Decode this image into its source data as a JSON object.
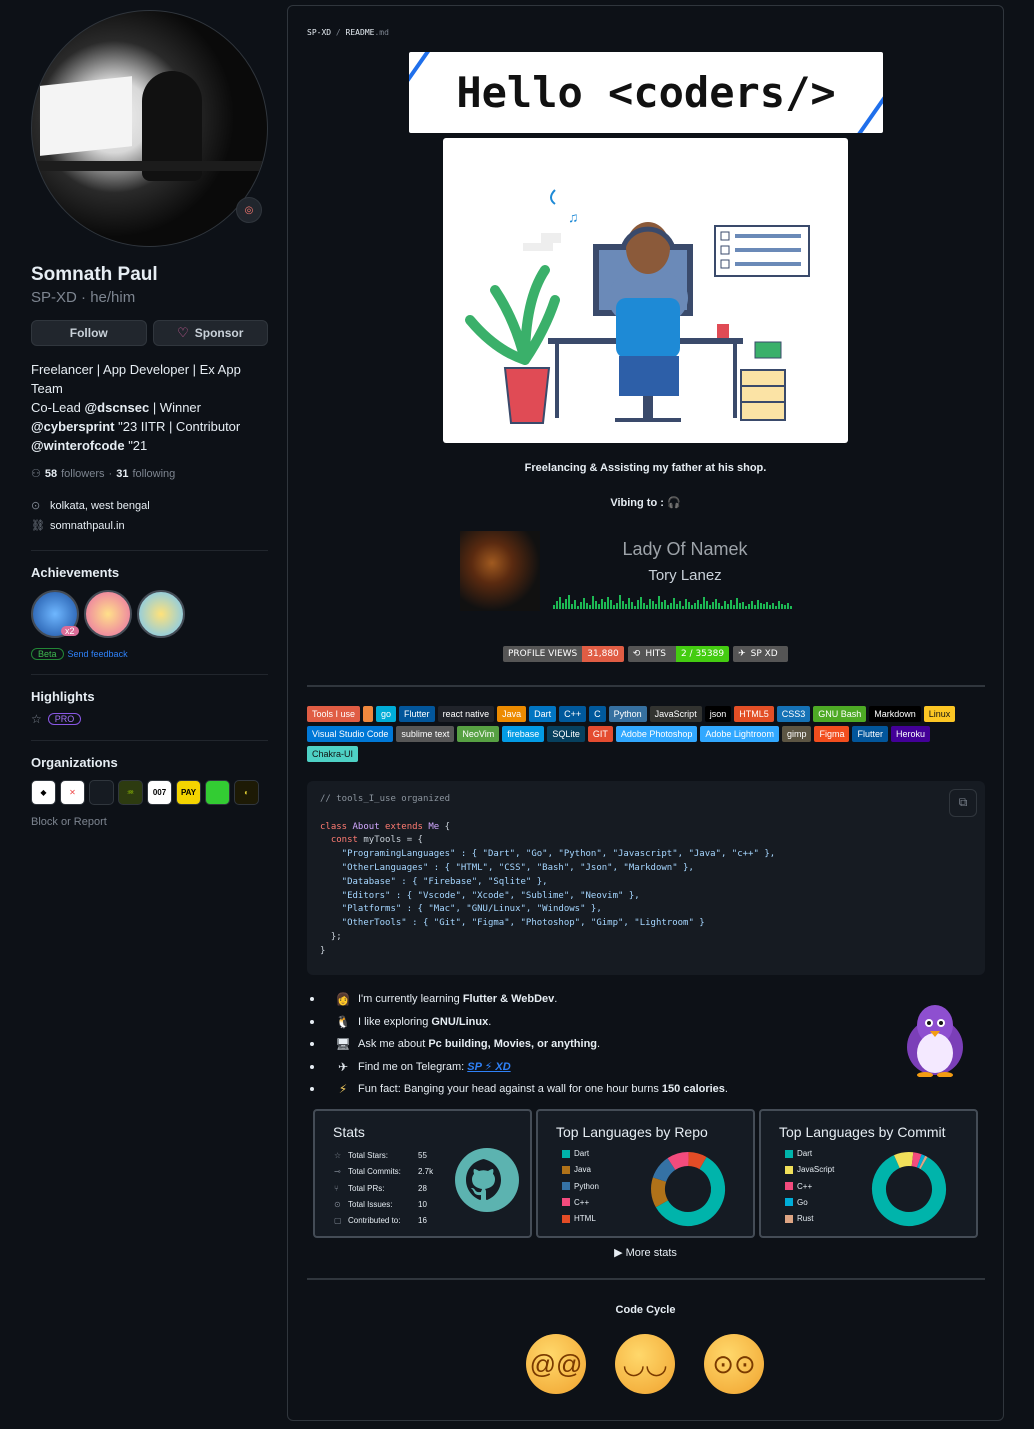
{
  "profile": {
    "name": "Somnath Paul",
    "login": "SP-XD",
    "pronouns": "he/him",
    "follow_label": "Follow",
    "sponsor_label": "Sponsor",
    "bio": {
      "l1": "Freelancer | App Developer | Ex App Team",
      "l2a": "Co-Lead ",
      "l2b": "@dscnsec",
      "l2c": " | Winner",
      "l3a": "@cybersprint",
      "l3b": " \"23 IITR | Contributor",
      "l4a": "@winterofcode",
      "l4b": " \"21"
    },
    "followers": "58",
    "followers_label": "followers",
    "following": "31",
    "following_label": "following",
    "location": "kolkata, west bengal",
    "website": "somnathpaul.in"
  },
  "achievements": {
    "title": "Achievements",
    "x2": "x2",
    "beta": "Beta",
    "feedback": "Send feedback"
  },
  "highlights": {
    "title": "Highlights",
    "pro": "PRO"
  },
  "organizations": {
    "title": "Organizations",
    "items": [
      "007",
      "PAY"
    ]
  },
  "block_report": "Block or Report",
  "readme": {
    "crumb_user": "SP-XD",
    "crumb_sep": " / ",
    "crumb_file": "README",
    "crumb_ext": ".md",
    "hello": "Hello <coders/>",
    "caption": "Freelancing & Assisting my father at his shop.",
    "vibing": "Vibing to : 🎧",
    "song": "Lady Of Namek",
    "artist": "Tory Lanez",
    "views_label": "PROFILE VIEWS",
    "views_value": "31,880",
    "hits_label": "HITS",
    "hits_value": "2 / 35389",
    "tg_label": "SP  XD"
  },
  "tools": [
    {
      "label": "Tools I use",
      "color": "#e05d44"
    },
    {
      "label": "",
      "color": "#f0883e"
    },
    {
      "label": "go",
      "color": "#00add8"
    },
    {
      "label": "Flutter",
      "color": "#02569b"
    },
    {
      "label": "react native",
      "color": "#20232a"
    },
    {
      "label": "Java",
      "color": "#ed8b00"
    },
    {
      "label": "Dart",
      "color": "#0175c2"
    },
    {
      "label": "C++",
      "color": "#00599c"
    },
    {
      "label": "C",
      "color": "#00599c"
    },
    {
      "label": "Python",
      "color": "#3670a0"
    },
    {
      "label": "JavaScript",
      "color": "#323330"
    },
    {
      "label": "json",
      "color": "#000000"
    },
    {
      "label": "HTML5",
      "color": "#e34f26"
    },
    {
      "label": "CSS3",
      "color": "#1572b6"
    },
    {
      "label": "GNU Bash",
      "color": "#4eaa25"
    },
    {
      "label": "Markdown",
      "color": "#000000"
    },
    {
      "label": "Linux",
      "color": "#fcc624"
    },
    {
      "label": "Visual Studio Code",
      "color": "#0078d7"
    },
    {
      "label": "sublime text",
      "color": "#575757"
    },
    {
      "label": "NeoVim",
      "color": "#57a143"
    },
    {
      "label": "firebase",
      "color": "#039be5"
    },
    {
      "label": "SQLite",
      "color": "#07405e"
    },
    {
      "label": "GIT",
      "color": "#e44c30"
    },
    {
      "label": "Adobe Photoshop",
      "color": "#31a8ff"
    },
    {
      "label": "Adobe Lightroom",
      "color": "#31a8ff"
    },
    {
      "label": "gimp",
      "color": "#5c5543"
    },
    {
      "label": "Figma",
      "color": "#f24e1e"
    },
    {
      "label": "Flutter",
      "color": "#02569b"
    },
    {
      "label": "Heroku",
      "color": "#430098"
    },
    {
      "label": "Chakra-UI",
      "color": "#4ed1c5"
    }
  ],
  "code": {
    "comment": "// tools_I_use organized",
    "l1": "class About extends Me {",
    "l2": "  const myTools = {",
    "l3": "    \"ProgramingLanguages\" : { \"Dart\", \"Go\", \"Python\", \"Javascript\", \"Java\", \"c++\" },",
    "l4": "    \"OtherLanguages\" : { \"HTML\", \"CSS\", \"Bash\", \"Json\", \"Markdown\" },",
    "l5": "    \"Database\" : { \"Firebase\", \"Sqlite\" },",
    "l6": "    \"Editors\" : { \"Vscode\", \"Xcode\", \"Sublime\", \"Neovim\" },",
    "l7": "    \"Platforms\" : { \"Mac\", \"GNU/Linux\", \"Windows\" },",
    "l8": "    \"OtherTools\" : { \"Git\", \"Figma\", \"Photoshop\", \"Gimp\", \"Lightroom\" }",
    "l9": "  };",
    "l10": "}"
  },
  "bullets": {
    "b1a": "I'm currently learning ",
    "b1b": "Flutter & WebDev",
    "b2a": "I like exploring ",
    "b2b": "GNU/Linux",
    "b3a": "Ask me about ",
    "b3b": "Pc building, Movies, or anything",
    "b4a": "Find me on Telegram: ",
    "b4b": "SP ⚡ XD",
    "b5a": "Fun fact: Banging your head against a wall for one hour burns ",
    "b5b": "150 calories",
    "end": "."
  },
  "stats": {
    "title": "Stats",
    "rows": [
      {
        "label": "Total Stars:",
        "value": "55",
        "icon": "☆"
      },
      {
        "label": "Total Commits:",
        "value": "2.7k",
        "icon": "⊸"
      },
      {
        "label": "Total PRs:",
        "value": "28",
        "icon": "⑂"
      },
      {
        "label": "Total Issues:",
        "value": "10",
        "icon": "⊙"
      },
      {
        "label": "Contributed to:",
        "value": "16",
        "icon": "▢"
      }
    ]
  },
  "top_repo": {
    "title": "Top Languages by Repo",
    "langs": [
      {
        "name": "Dart",
        "color": "#00b4ab"
      },
      {
        "name": "Java",
        "color": "#b07219"
      },
      {
        "name": "Python",
        "color": "#3572a5"
      },
      {
        "name": "C++",
        "color": "#f34b7d"
      },
      {
        "name": "HTML",
        "color": "#e34c26"
      }
    ]
  },
  "top_commit": {
    "title": "Top Languages by Commit",
    "langs": [
      {
        "name": "Dart",
        "color": "#00b4ab"
      },
      {
        "name": "JavaScript",
        "color": "#f1e05a"
      },
      {
        "name": "C++",
        "color": "#f34b7d"
      },
      {
        "name": "Go",
        "color": "#00add8"
      },
      {
        "name": "Rust",
        "color": "#dea584"
      }
    ]
  },
  "more_stats": "▶ More stats",
  "code_cycle": "Code Cycle"
}
